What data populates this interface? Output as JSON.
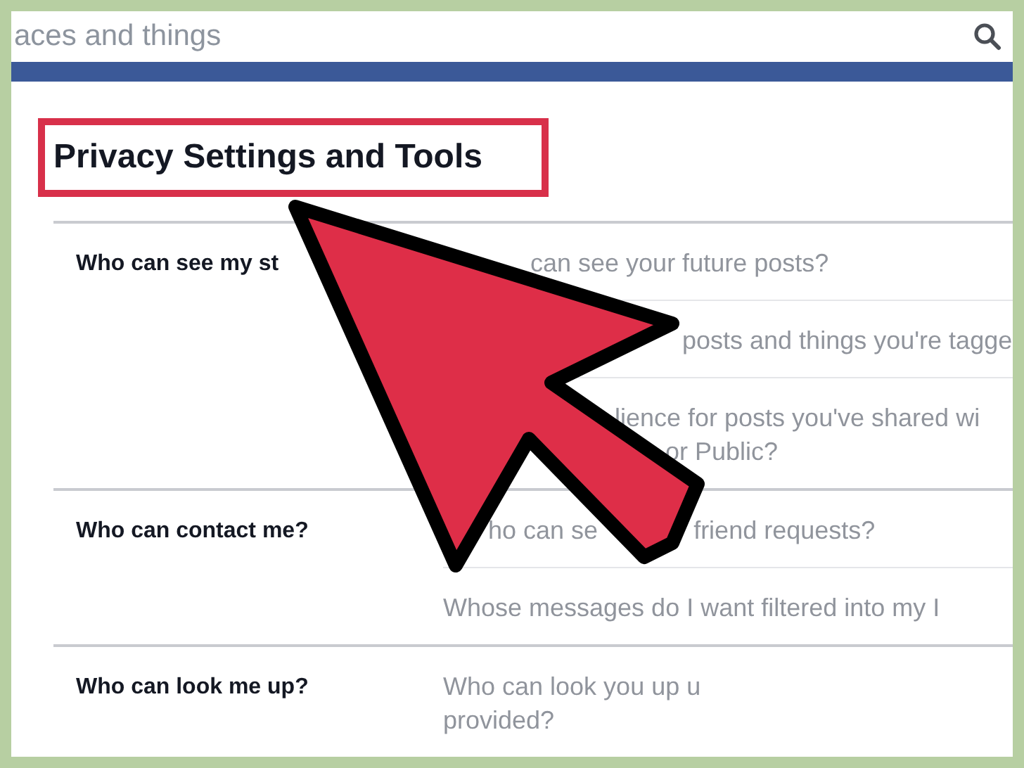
{
  "search": {
    "value": "aces and things"
  },
  "title": "Privacy Settings and Tools",
  "sections": [
    {
      "label": "Who can see my st",
      "items": [
        {
          "lines": [
            [
              "can see your future posts?"
            ]
          ]
        },
        {
          "lines": [
            [
              "posts and things you're tagge"
            ]
          ]
        },
        {
          "lines": [
            [
              "lience for posts you've shared wi"
            ],
            [
              "or Public?"
            ]
          ]
        }
      ]
    },
    {
      "label": "Who can contact me?",
      "items": [
        {
          "lines": [
            [
              "ho can se",
              "friend requests?"
            ]
          ]
        },
        {
          "lines": [
            [
              "Whose messages do I want filtered into my I"
            ]
          ]
        }
      ]
    },
    {
      "label": "Who can look me up?",
      "items": [
        {
          "lines": [
            [
              "Who can look you up u"
            ],
            [
              "provided?"
            ]
          ]
        }
      ]
    }
  ]
}
